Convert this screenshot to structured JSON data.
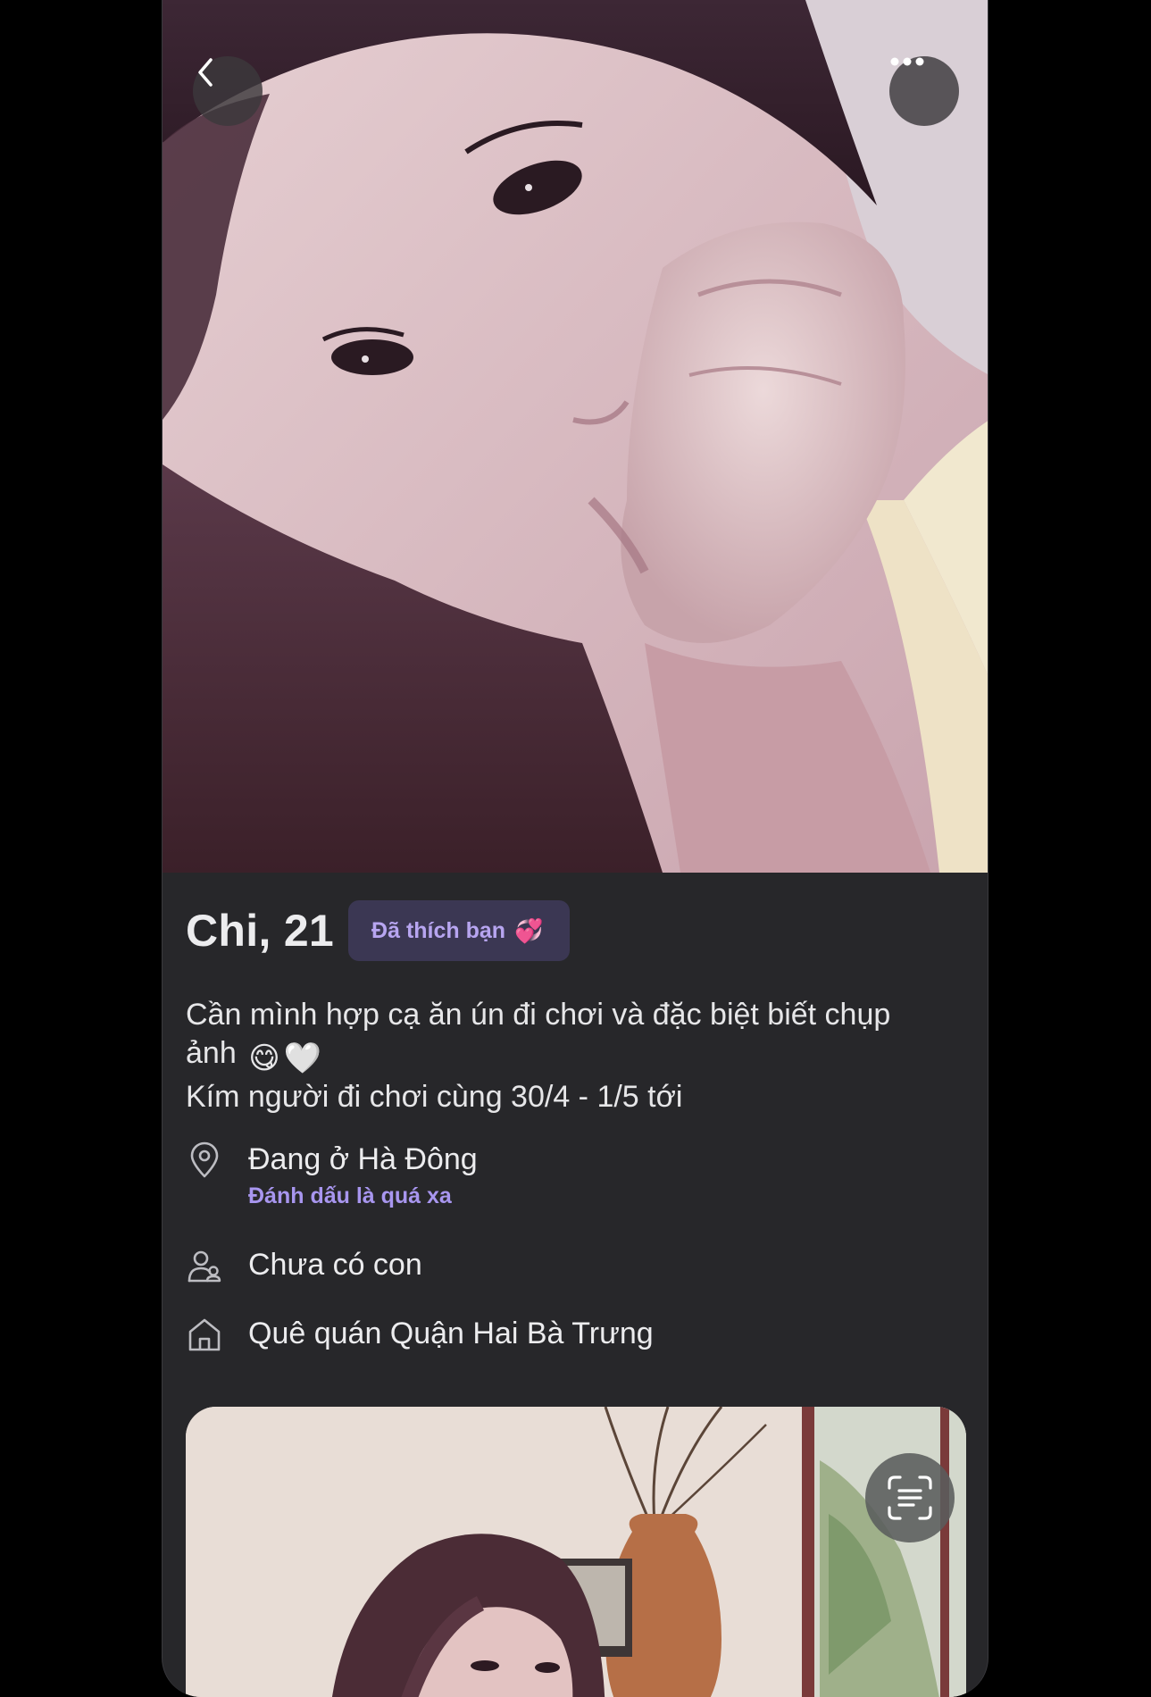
{
  "profile": {
    "name_age": "Chi, 21",
    "liked_badge": "Đã thích bạn",
    "liked_badge_emoji": "💞"
  },
  "bio": {
    "line1": "Cần mình hợp cạ ăn ún đi chơi và đặc biệt biết chụp",
    "line2_text": "ảnh",
    "line2_emojis": [
      "😋",
      "🤍"
    ],
    "line3": "Kím người đi chơi cùng 30/4 - 1/5 tới"
  },
  "facts": {
    "location": "Đang ở Hà Đông",
    "location_action": "Đánh dấu là quá xa",
    "children": "Chưa có con",
    "hometown": "Quê quán Quận Hai Bà Trưng"
  },
  "icons": {
    "back": "chevron-left-icon",
    "more": "more-horizontal-icon",
    "location": "map-pin-icon",
    "children": "people-icon",
    "hometown": "home-icon",
    "scan": "text-scan-icon"
  },
  "colors": {
    "background": "#000000",
    "card": "#27272a",
    "badge_bg": "#3b3753",
    "accent": "#a896ef",
    "text": "#ececee"
  }
}
